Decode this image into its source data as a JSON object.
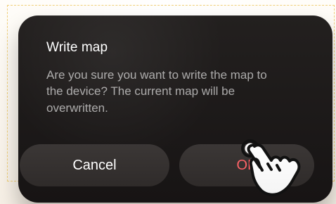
{
  "dialog": {
    "title": "Write map",
    "message": "Are you sure you want to write the map to the device? The current map will be overwritten.",
    "cancel_label": "Cancel",
    "ok_label": "OK"
  },
  "colors": {
    "dialog_background": "#1f1c1b",
    "button_background": "#353130",
    "title_text": "#ffffff",
    "message_text": "#9e9a99",
    "ok_text": "#ff6367",
    "guide_border": "#f0cf78"
  },
  "icons": {
    "pointer": "hand-pointer-icon"
  }
}
